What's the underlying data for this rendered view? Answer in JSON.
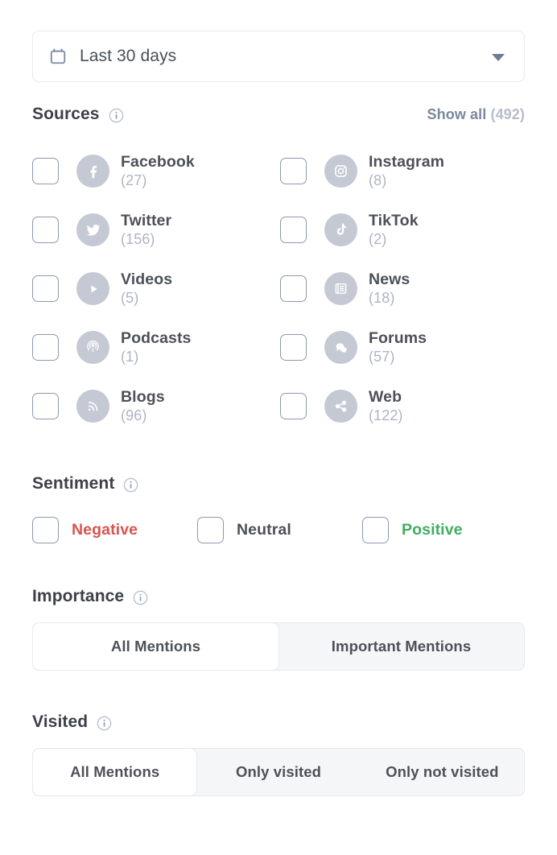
{
  "date_filter": {
    "icon": "calendar-icon",
    "value": "Last 30 days",
    "caret": "chevron-down-icon"
  },
  "sources": {
    "title": "Sources",
    "info_icon": "info-icon",
    "show_all_label": "Show all",
    "show_all_count": "(492)",
    "items": [
      {
        "name": "Facebook",
        "count": "(27)",
        "icon": "facebook-icon",
        "checked": false
      },
      {
        "name": "Instagram",
        "count": "(8)",
        "icon": "instagram-icon",
        "checked": false
      },
      {
        "name": "Twitter",
        "count": "(156)",
        "icon": "twitter-icon",
        "checked": false
      },
      {
        "name": "TikTok",
        "count": "(2)",
        "icon": "tiktok-icon",
        "checked": false
      },
      {
        "name": "Videos",
        "count": "(5)",
        "icon": "play-icon",
        "checked": false
      },
      {
        "name": "News",
        "count": "(18)",
        "icon": "newspaper-icon",
        "checked": false
      },
      {
        "name": "Podcasts",
        "count": "(1)",
        "icon": "podcast-icon",
        "checked": false
      },
      {
        "name": "Forums",
        "count": "(57)",
        "icon": "chat-icon",
        "checked": false
      },
      {
        "name": "Blogs",
        "count": "(96)",
        "icon": "rss-icon",
        "checked": false
      },
      {
        "name": "Web",
        "count": "(122)",
        "icon": "share-icon",
        "checked": false
      }
    ]
  },
  "sentiment": {
    "title": "Sentiment",
    "info_icon": "info-icon",
    "options": [
      {
        "label": "Negative",
        "color": "#d9534f",
        "checked": false
      },
      {
        "label": "Neutral",
        "color": "#4c5159",
        "checked": false
      },
      {
        "label": "Positive",
        "color": "#3fae5f",
        "checked": false
      }
    ]
  },
  "importance": {
    "title": "Importance",
    "info_icon": "info-icon",
    "options": [
      {
        "label": "All Mentions",
        "active": true
      },
      {
        "label": "Important Mentions",
        "active": false
      }
    ]
  },
  "visited": {
    "title": "Visited",
    "info_icon": "info-icon",
    "options": [
      {
        "label": "All Mentions",
        "active": true
      },
      {
        "label": "Only visited",
        "active": false
      },
      {
        "label": "Only not visited",
        "active": false
      }
    ]
  },
  "colors": {
    "badge": "#c5c9d4",
    "checkbox_border": "#8d98ae",
    "link": "#7b879e",
    "muted": "#aeb5c3",
    "text": "#4c5159",
    "negative": "#d9534f",
    "positive": "#3fae5f",
    "track": "#f5f6f8",
    "border": "#e7e9ee"
  }
}
